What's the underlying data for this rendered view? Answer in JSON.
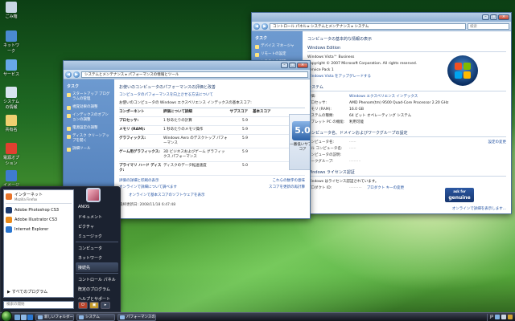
{
  "desktop": {
    "icons": [
      {
        "label": "ごみ箱",
        "color": "#c9d6e4"
      },
      {
        "label": "ネットワーク",
        "color": "#4a8ad0"
      },
      {
        "label": "サービス",
        "color": "#67a8e8"
      },
      {
        "label": "システムの情報",
        "color": "#d8e4f0"
      },
      {
        "label": "共有名",
        "color": "#f0d070"
      },
      {
        "label": "電源オプション",
        "color": "#e04030"
      },
      {
        "label": "イメージ",
        "color": "#3f7bd0"
      }
    ]
  },
  "system_window": {
    "address": "コントロール パネル ▸ システムとメンテナンス ▸ システム",
    "search_placeholder": "検索",
    "tasks_header": "タスク",
    "tasks": [
      "デバイス マネージャ",
      "リモートの設定",
      "システムの保護",
      "システムの詳細設定"
    ],
    "heading": "コンピュータの基本的な情報の表示",
    "edition_section": "Windows Edition",
    "edition": "Windows Vista™ Business",
    "copyright": "Copyright © 2007 Microsoft Corporation.  All rights reserved.",
    "service_pack": "Service Pack 1",
    "upgrade_link": "Windows Vista をアップグレードする",
    "system_section": "システム",
    "rating_label": "評価:",
    "rating_link": "Windows エクスペリエンス インデックス",
    "processor_label": "プロセッサ:",
    "processor_value": "AMD Phenom(tm) 9500 Quad-Core Processor   2.20 GHz",
    "memory_label": "メモリ (RAM):",
    "memory_value": "16.0 GB",
    "systype_label": "システムの種類:",
    "systype_value": "64 ビット オペレーティング システム",
    "pen_label": "タブレット PC の機能:",
    "pen_value": "利用可能",
    "domain_section": "コンピュータ名、ドメインおよびワークグループの設定",
    "pcname_label": "コンピュータ名:",
    "fullname_label": "フル コンピュータ名:",
    "desc_label": "コンピュータの説明:",
    "workgroup_label": "ワークグループ:",
    "change_settings": "設定の変更",
    "activation_section": "Windows ライセンス認証",
    "activation_text": "Windows はライセンス認証されています。",
    "productid_label": "プロダクト ID:",
    "productkey_link": "プロダクト キーの変更",
    "genuine_line1": "ask for",
    "genuine_line2": "genuine",
    "genuine_line3": "Microsoft software",
    "online_link": "オンラインで詳細を表示します..."
  },
  "perf_window": {
    "address": "システムとメンテナンス ▸ パフォーマンスの情報とツール",
    "tasks_header": "タスク",
    "tasks": [
      "スタートアップ プログラムの管理",
      "視覚効果の調整",
      "インデックスのオプションの調整",
      "電源設定の調整",
      "ディスク クリーンアップを開く",
      "詳細ツール"
    ],
    "heading": "お使いのコンピュータのパフォーマンスの評価と改善",
    "info_link": "コンピュータのパフォーマンスを向上させる方法について",
    "base_label": "お使いのコンピュータの Windows エクスペリエンス インデックスの基本スコア:",
    "col_component": "コンポーネント",
    "col_detail": "評価について詳細",
    "col_subscore": "サブスコア",
    "col_base": "基本スコア",
    "rows": [
      {
        "c": "プロセッサ:",
        "d": "1 秒あたりの計算",
        "s": "5.9"
      },
      {
        "c": "メモリ (RAM):",
        "d": "1 秒あたりのメモリ操作",
        "s": "5.9"
      },
      {
        "c": "グラフィックス:",
        "d": "Windows Aero のデスクトップ パフォーマンス",
        "s": "5.9"
      },
      {
        "c": "ゲーム用グラフィックス:",
        "d": "3D ビジネスおよびゲーム グラフィックス パフォーマンス",
        "s": "5.9"
      },
      {
        "c": "プライマリ ハード ディスク:",
        "d": "ディスクのデータ転送速度",
        "s": "5.0"
      }
    ],
    "base_score": "5.0",
    "base_caption": "一番低いサブスコア",
    "print_link": "評価の詳細と印刷の表示",
    "meaning_link": "これらの数字の意味",
    "refresh_link": "スコアを更新の再計算",
    "learn_link": "オンラインで詳細について調べます",
    "offer_link": "オンラインで基本スコアのソフトウェアを表示",
    "updated": "最終更新日: 2008/11/18 6:47:48"
  },
  "start_menu": {
    "pinned": [
      {
        "label": "インターネット",
        "sub": "Mozilla Firefox",
        "color": "#e8742a"
      },
      {
        "label": "Adobe Photoshop CS3",
        "sub": "",
        "color": "#1b3a6e"
      },
      {
        "label": "Adobe Illustrator CS3",
        "sub": "",
        "color": "#e98a1a"
      },
      {
        "label": "Internet Explorer",
        "sub": "",
        "color": "#2a76d0"
      }
    ],
    "all_programs": "すべてのプログラム",
    "search_placeholder": "検索の開始",
    "right_items": [
      "ANOS",
      "ドキュメント",
      "ピクチャ",
      "ミュージック",
      "コンピュータ",
      "ネットワーク",
      "接続先",
      "コントロール パネル",
      "既定のプログラム",
      "ヘルプとサポート"
    ],
    "highlighted": "接続先"
  },
  "taskbar": {
    "tasks": [
      "新しいフォルダー - Mozil...",
      "システム",
      "パフォーマンスの情..."
    ],
    "lang": "JP"
  }
}
